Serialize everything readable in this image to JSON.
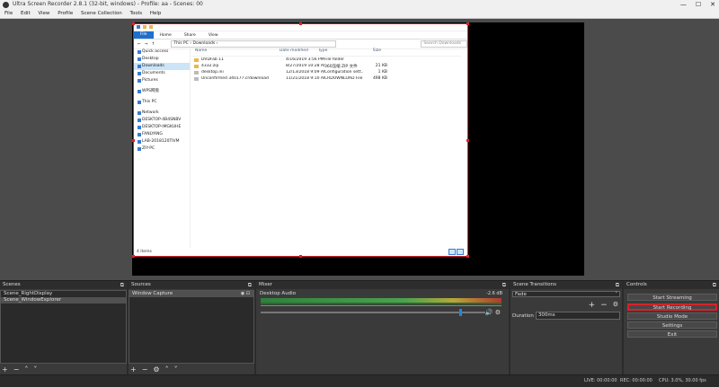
{
  "window": {
    "title": "Ultra Screen Recorder 2.8.1 (32-bit, windows) - Profile: aa - Scenes: 00",
    "controls": [
      "—",
      "☐",
      "✕"
    ]
  },
  "menu": [
    "File",
    "Edit",
    "View",
    "Profile",
    "Scene Collection",
    "Tools",
    "Help"
  ],
  "explorer": {
    "ribbon": [
      "File",
      "Home",
      "Share",
      "View"
    ],
    "address": "This PC › Downloads ›",
    "search_placeholder": "Search Downloads",
    "nav": [
      {
        "label": "Quick access",
        "selected": false
      },
      {
        "label": "Desktop",
        "selected": false
      },
      {
        "label": "Downloads",
        "selected": true
      },
      {
        "label": "Documents",
        "selected": false
      },
      {
        "label": "Pictures",
        "selected": false
      },
      {
        "label": "WPS网盘",
        "selected": false
      },
      {
        "label": "This PC",
        "selected": false
      },
      {
        "label": "Network",
        "selected": false
      },
      {
        "label": "DESKTOP-4B4SNBV",
        "selected": false
      },
      {
        "label": "DESKTOP-IMGKUHE",
        "selected": false
      },
      {
        "label": "FANLYANG",
        "selected": false
      },
      {
        "label": "LAB-2018120TIVM",
        "selected": false
      },
      {
        "label": "ZIY-PC",
        "selected": false
      }
    ],
    "columns": [
      "Name",
      "Date modified",
      "Type",
      "Size"
    ],
    "files": [
      {
        "name": "DVDFab 11",
        "date": "4/16/2019 3:56 PM",
        "type": "File folder",
        "size": ""
      },
      {
        "name": "4332.zip",
        "date": "8/27/2019 10:28 AM",
        "type": "360压缩 ZIP 文件",
        "size": "21 KB"
      },
      {
        "name": "desktop.ini",
        "date": "12/13/2018 9:09 AM",
        "type": "Configuration sett...",
        "size": "1 KB"
      },
      {
        "name": "Unconfirmed 340177.crdownload",
        "date": "11/21/2018 9:10 AM",
        "type": "CRDOWNLOAD File",
        "size": "498 KB"
      }
    ],
    "status": "4 items"
  },
  "scenes": {
    "title": "Scenes",
    "items": [
      {
        "label": "Scene_RightDisplay",
        "active": false
      },
      {
        "label": "Scene_WindowExplorer",
        "active": true
      }
    ]
  },
  "sources": {
    "title": "Sources",
    "items": [
      {
        "label": "Window Capture"
      }
    ]
  },
  "mixer": {
    "title": "Mixer",
    "channel": "Desktop Audio",
    "level": "-2.6 dB"
  },
  "transitions": {
    "title": "Scene Transitions",
    "selected": "Fade",
    "duration_label": "Duration",
    "duration_value": "300ms"
  },
  "controls": {
    "title": "Controls",
    "buttons": [
      "Start Streaming",
      "Start Recording",
      "Studio Mode",
      "Settings",
      "Exit"
    ]
  },
  "status": {
    "live": "LIVE: 00:00:00",
    "rec": "REC: 00:00:00",
    "cpu": "CPU: 3.0%, 30.00 fps"
  },
  "colors": {
    "selection": "#d8222a",
    "highlight": "#d8222a",
    "fader": "#1e88e5"
  }
}
